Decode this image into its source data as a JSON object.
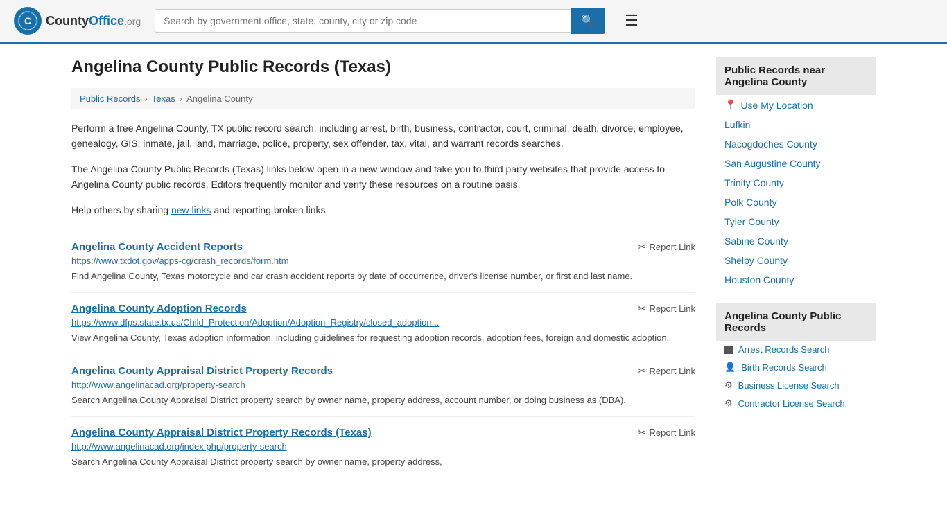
{
  "header": {
    "logo_text": "County",
    "logo_org": "Office.org",
    "search_placeholder": "Search by government office, state, county, city or zip code",
    "search_label": "Search"
  },
  "page": {
    "title": "Angelina County Public Records (Texas)",
    "breadcrumb": {
      "items": [
        "Public Records",
        "Texas",
        "Angelina County"
      ]
    },
    "description1": "Perform a free Angelina County, TX public record search, including arrest, birth, business, contractor, court, criminal, death, divorce, employee, genealogy, GIS, inmate, jail, land, marriage, police, property, sex offender, tax, vital, and warrant records searches.",
    "description2": "The Angelina County Public Records (Texas) links below open in a new window and take you to third party websites that provide access to Angelina County public records. Editors frequently monitor and verify these resources on a routine basis.",
    "description3_prefix": "Help others by sharing ",
    "description3_link": "new links",
    "description3_suffix": " and reporting broken links.",
    "records": [
      {
        "title": "Angelina County Accident Reports",
        "url": "https://www.txdot.gov/apps-cg/crash_records/form.htm",
        "description": "Find Angelina County, Texas motorcycle and car crash accident reports by date of occurrence, driver's license number, or first and last name.",
        "report_label": "Report Link"
      },
      {
        "title": "Angelina County Adoption Records",
        "url": "https://www.dfps.state.tx.us/Child_Protection/Adoption/Adoption_Registry/closed_adoption...",
        "description": "View Angelina County, Texas adoption information, including guidelines for requesting adoption records, adoption fees, foreign and domestic adoption.",
        "report_label": "Report Link"
      },
      {
        "title": "Angelina County Appraisal District Property Records",
        "url": "http://www.angelinacad.org/property-search",
        "description": "Search Angelina County Appraisal District property search by owner name, property address, account number, or doing business as (DBA).",
        "report_label": "Report Link"
      },
      {
        "title": "Angelina County Appraisal District Property Records (Texas)",
        "url": "http://www.angelinacad.org/index.php/property-search",
        "description": "Search Angelina County Appraisal District property search by owner name, property address,",
        "report_label": "Report Link"
      }
    ]
  },
  "sidebar": {
    "nearby_section": {
      "header": "Public Records near Angelina County",
      "use_my_location": "Use My Location",
      "items": [
        "Lufkin",
        "Nacogdoches County",
        "San Augustine County",
        "Trinity County",
        "Polk County",
        "Tyler County",
        "Sabine County",
        "Shelby County",
        "Houston County"
      ]
    },
    "local_section": {
      "header": "Angelina County Public Records",
      "items": [
        "Arrest Records Search",
        "Birth Records Search",
        "Business License Search",
        "Contractor License Search"
      ]
    }
  }
}
